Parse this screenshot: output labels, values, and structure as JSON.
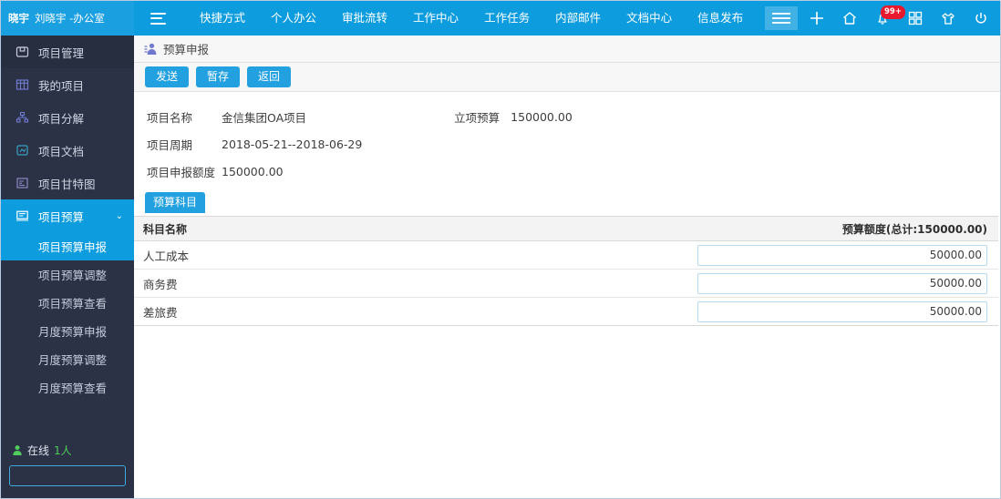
{
  "topbar": {
    "user_badge": "晓宇",
    "user_name": "刘晓宇 -办公室",
    "nav_items": [
      {
        "label": "快捷方式"
      },
      {
        "label": "个人办公"
      },
      {
        "label": "审批流转"
      },
      {
        "label": "工作中心"
      },
      {
        "label": "工作任务"
      },
      {
        "label": "内部邮件"
      },
      {
        "label": "文档中心"
      },
      {
        "label": "信息发布"
      }
    ],
    "icons": [
      {
        "name": "plus-icon"
      },
      {
        "name": "home-icon"
      },
      {
        "name": "bell-icon",
        "badge": "99+"
      },
      {
        "name": "apps-grid-icon"
      },
      {
        "name": "theme-shirt-icon"
      },
      {
        "name": "power-icon"
      }
    ],
    "accent_color": "#0d9cde"
  },
  "sidebar": {
    "header": {
      "label": "项目管理",
      "icon": "folder-icon"
    },
    "items": [
      {
        "label": "我的项目",
        "icon": "table-icon",
        "active": false
      },
      {
        "label": "项目分解",
        "icon": "sitemap-icon",
        "active": false
      },
      {
        "label": "项目文档",
        "icon": "document-icon",
        "active": false
      },
      {
        "label": "项目甘特图",
        "icon": "gantt-icon",
        "active": false
      },
      {
        "label": "项目预算",
        "icon": "budget-icon",
        "active": true,
        "expanded": true
      }
    ],
    "sub_items": [
      {
        "label": "项目预算申报",
        "active": true
      },
      {
        "label": "项目预算调整",
        "active": false
      },
      {
        "label": "项目预算查看",
        "active": false
      },
      {
        "label": "月度预算申报",
        "active": false
      },
      {
        "label": "月度预算调整",
        "active": false
      },
      {
        "label": "月度预算查看",
        "active": false
      }
    ],
    "online_label": "在线",
    "online_count": "1人",
    "search_value": "",
    "search_placeholder": "",
    "bg_color": "#2b3245",
    "active_color": "#0d9cde",
    "online_color": "#4fcc5c"
  },
  "main": {
    "page_title": "预算申报",
    "buttons": [
      {
        "label": "发送",
        "name": "send-button"
      },
      {
        "label": "暂存",
        "name": "save-draft-button"
      },
      {
        "label": "返回",
        "name": "return-button"
      }
    ],
    "form": {
      "project_name_label": "项目名称",
      "project_name_value": "金信集团OA项目",
      "approved_budget_label": "立项预算",
      "approved_budget_value": "150000.00",
      "period_label": "项目周期",
      "period_value": "2018-05-21--2018-06-29",
      "declared_amount_label": "项目申报额度",
      "declared_amount_value": "150000.00"
    },
    "tab": {
      "label": "预算科目"
    },
    "table": {
      "columns": [
        "科目名称",
        "预算额度(总计:150000.00)"
      ],
      "rows": [
        {
          "name": "人工成本",
          "amount": "50000.00"
        },
        {
          "name": "商务费",
          "amount": "50000.00"
        },
        {
          "name": "差旅费",
          "amount": "50000.00"
        }
      ]
    }
  }
}
